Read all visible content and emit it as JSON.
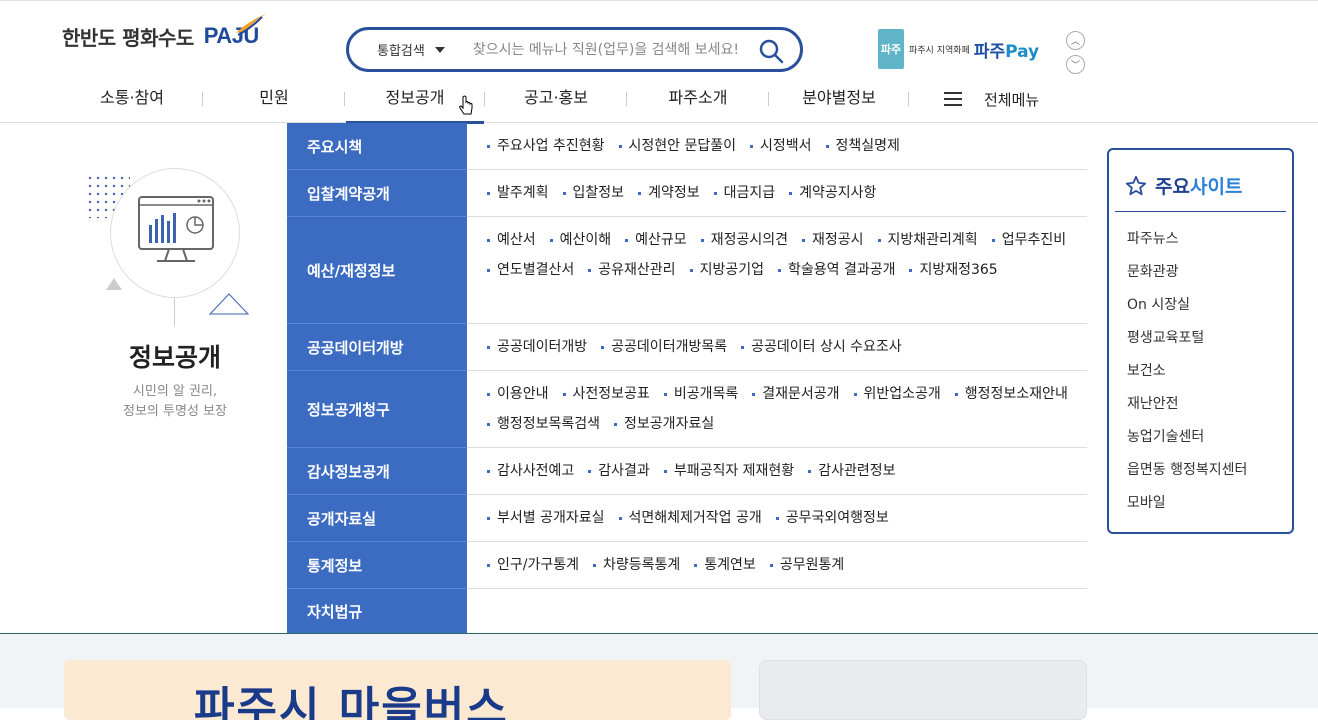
{
  "header": {
    "logo_text": "한반도 평화수도",
    "logo_mark": "PAJU",
    "search": {
      "category": "통합검색",
      "placeholder": "찾으시는 메뉴나 직원(업무)을 검색해 보세요!"
    },
    "pay": {
      "box_text": "파주",
      "small_text": "파주시 지역화폐",
      "brand_ko": "파주",
      "brand_en": "Pay"
    }
  },
  "gnb": {
    "items": [
      "소통·참여",
      "민원",
      "정보공개",
      "공고·홍보",
      "파주소개",
      "분야별정보"
    ],
    "active": "정보공개",
    "all_menu": "전체메뉴"
  },
  "intro": {
    "title": "정보공개",
    "desc_line1": "시민의 알 권리,",
    "desc_line2": "정보의 투명성 보장"
  },
  "menu": [
    {
      "category": "주요시책",
      "links": [
        "주요사업 추진현황",
        "시정현안 문답풀이",
        "시정백서",
        "정책실명제"
      ]
    },
    {
      "category": "입찰계약공개",
      "links": [
        "발주계획",
        "입찰정보",
        "계약정보",
        "대금지급",
        "계약공지사항"
      ]
    },
    {
      "category": "예산/재정정보",
      "links": [
        "예산서",
        "예산이해",
        "예산규모",
        "재정공시의견",
        "재정공시",
        "지방채관리계획",
        "업무추진비",
        "연도별결산서",
        "공유재산관리",
        "지방공기업",
        "학술용역 결과공개",
        "지방재정365"
      ]
    },
    {
      "category": "공공데이터개방",
      "links": [
        "공공데이터개방",
        "공공데이터개방목록",
        "공공데이터 상시 수요조사"
      ]
    },
    {
      "category": "정보공개청구",
      "links": [
        "이용안내",
        "사전정보공표",
        "비공개목록",
        "결재문서공개",
        "위반업소공개",
        "행정정보소재안내",
        "행정정보목록검색",
        "정보공개자료실"
      ]
    },
    {
      "category": "감사정보공개",
      "links": [
        "감사사전예고",
        "감사결과",
        "부패공직자 제재현황",
        "감사관련정보"
      ]
    },
    {
      "category": "공개자료실",
      "links": [
        "부서별 공개자료실",
        "석면해체제거작업 공개",
        "공무국외여행정보"
      ]
    },
    {
      "category": "통계정보",
      "links": [
        "인구/가구통계",
        "차량등록통계",
        "통계연보",
        "공무원통계"
      ]
    },
    {
      "category": "자치법규",
      "links": []
    }
  ],
  "sites": {
    "title_a": "주요",
    "title_b": "사이트",
    "items": [
      "파주뉴스",
      "문화관광",
      "On 시장실",
      "평생교육포털",
      "보건소",
      "재난안전",
      "농업기술센터",
      "읍면동 행정복지센터",
      "모바일"
    ]
  },
  "bottom": {
    "banner_text": "파주시 마을버스"
  },
  "colors": {
    "primary": "#2a4f9b",
    "category_bg": "#3c6bc2",
    "accent": "#2b7fd8"
  }
}
